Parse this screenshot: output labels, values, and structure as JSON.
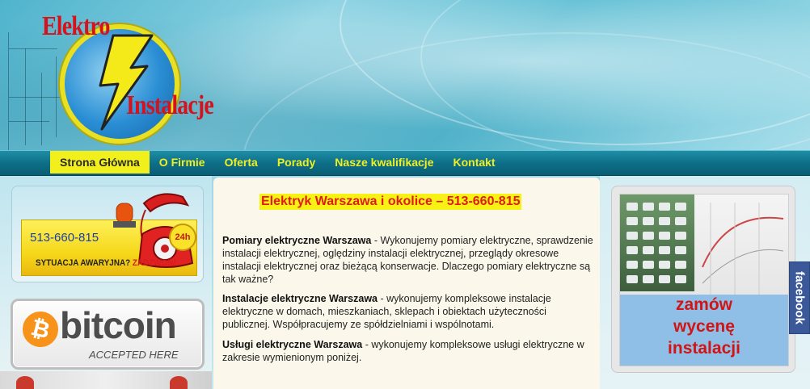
{
  "logo": {
    "line1": "Elektro",
    "line2": "Instalacje",
    "brand_color": "#d6121d",
    "accent_color": "#e8e020"
  },
  "nav": {
    "items": [
      {
        "label": "Strona Główna",
        "active": true
      },
      {
        "label": "O Firmie",
        "active": false
      },
      {
        "label": "Oferta",
        "active": false
      },
      {
        "label": "Porady",
        "active": false
      },
      {
        "label": "Nasze kwalifikacje",
        "active": false
      },
      {
        "label": "Kontakt",
        "active": false
      }
    ],
    "active_bg": "#f2f01c",
    "link_color": "#f0f020"
  },
  "emergency": {
    "phone": "513-660-815",
    "badge": "24h",
    "situation": "SYTUACJA AWARYJNA?",
    "call_to_action": "ZADZWOŃ!",
    "icon": "red-telephone-icon"
  },
  "bitcoin": {
    "symbol": "₿",
    "word": "bitcoin",
    "accepted": "ACCEPTED HERE",
    "color": "#f7931a"
  },
  "main": {
    "headline": "Elektryk Warszawa i okolice – 513-660-815",
    "paragraphs": [
      {
        "title": "Pomiary elektryczne Warszawa",
        "body": " - Wykonujemy pomiary elektryczne, sprawdzenie instalacji elektrycznej, oględziny instalacji elektrycznej, przeglądy okresowe instalacji elektrycznej oraz bieżącą konserwacje. Dlaczego pomiary elektryczne są tak ważne?"
      },
      {
        "title": "Instalacje elektryczne Warszawa",
        "body": " - wykonujemy kompleksowe instalacje elektryczne w domach, mieszkaniach, sklepach i obiektach użyteczności publicznej. Współpracujemy ze spółdzielniami i wspólnotami."
      },
      {
        "title": "Usługi elektryczne Warszawa",
        "body": " - wykonujemy kompleksowe usługi elektryczne w zakresie wymienionym poniżej."
      }
    ]
  },
  "quote": {
    "line1": "zamów",
    "line2": "wycenę",
    "line3": "instalacji",
    "text_color": "#d21414"
  },
  "facebook": {
    "label": "facebook",
    "color": "#3b5998"
  }
}
